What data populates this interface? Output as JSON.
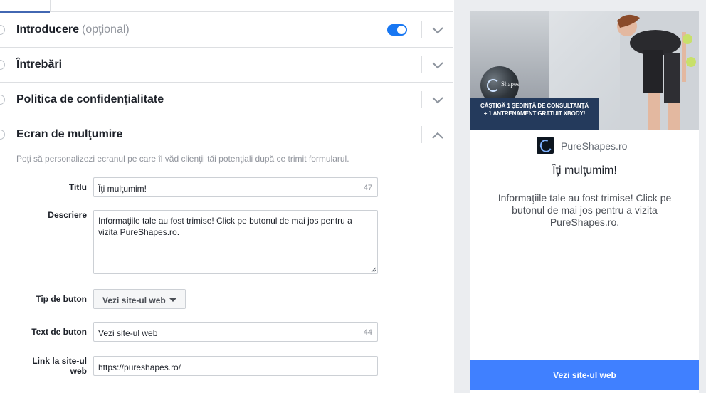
{
  "sections": [
    {
      "title": "Introducere",
      "optional": "(opţional)"
    },
    {
      "title": "Întrebări"
    },
    {
      "title": "Politica de confidenţialitate"
    },
    {
      "title": "Ecran de mulţumire"
    }
  ],
  "thank_you_screen": {
    "intro": "Poţi să personalizezi ecranul pe care îl văd clienţii tăi potenţiali după ce trimit formularul.",
    "title_label": "Titlu",
    "title_value": "Îţi mulţumim!",
    "title_count": "47",
    "description_label": "Descriere",
    "description_value": "Informaţiile tale au fost trimise!  Click pe butonul de mai jos pentru a vizita PureShapes.ro.",
    "button_type_label": "Tip de buton",
    "button_type_value": "Vezi site-ul web",
    "button_text_label": "Text de buton",
    "button_text_value": "Vezi site-ul web",
    "button_text_count": "44",
    "link_label": "Link la site-ul web",
    "link_value": "https://pureshapes.ro/"
  },
  "preview": {
    "hero_brand": "Shapes",
    "hero_banner_line1": "CÂŞTIGĂ 1 ŞEDINŢĂ DE CONSULTANŢĂ",
    "hero_banner_line2": "+ 1 ANTRENAMENT GRATUIT XBODY!",
    "brand_name": "PureShapes.ro",
    "thanks_title": "Îţi mulţumim!",
    "thanks_description": "Informaţiile tale au fost trimise! Click pe butonul de mai jos pentru a vizita PureShapes.ro.",
    "cta_label": "Vezi site-ul web"
  },
  "colors": {
    "accent": "#4080ff",
    "toggle_on": "#1877f2",
    "tab_underline": "#4267b2"
  }
}
